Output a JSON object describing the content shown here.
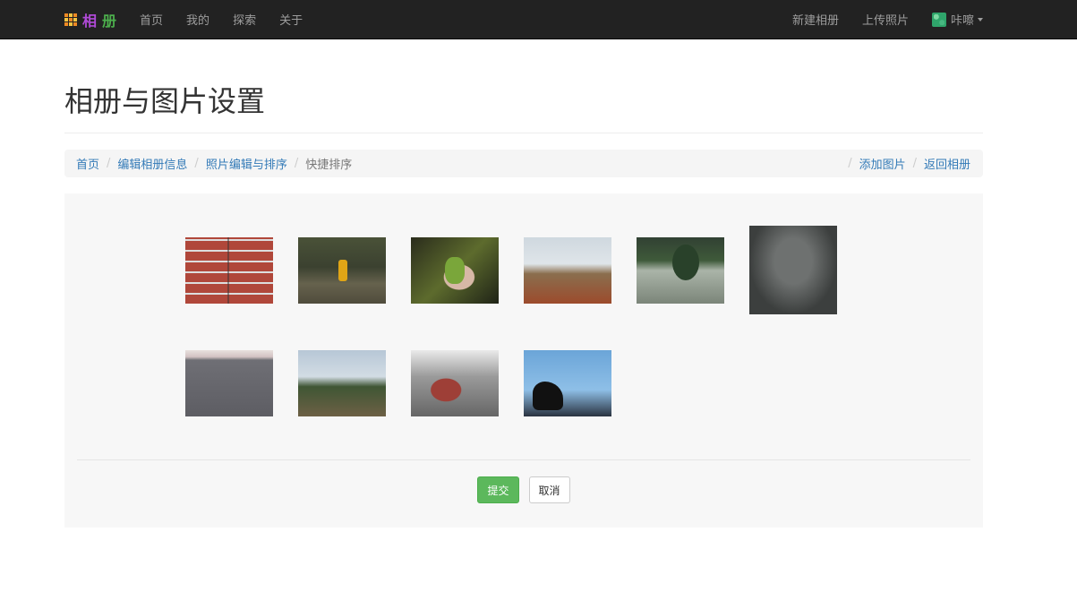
{
  "brand": {
    "chars": [
      "相",
      "册"
    ],
    "icon": "album-grid-icon",
    "char_colors": [
      "#b04ad8",
      "#4cae4c"
    ]
  },
  "nav": {
    "left": [
      "首页",
      "我的",
      "探索",
      "关于"
    ],
    "right": [
      "新建相册",
      "上传照片"
    ],
    "user_name": "咔嚓"
  },
  "page_title": "相册与图片设置",
  "breadcrumb": {
    "items": [
      "首页",
      "编辑相册信息",
      "照片编辑与排序"
    ],
    "active": "快捷排序",
    "right": [
      "添加图片",
      "返回相册"
    ]
  },
  "photos": [
    {
      "name": "brick-wall-photo"
    },
    {
      "name": "child-walking-photo"
    },
    {
      "name": "grasshopper-photo"
    },
    {
      "name": "field-trees-photo"
    },
    {
      "name": "tree-reflection-photo"
    },
    {
      "name": "water-photo"
    },
    {
      "name": "road-photo"
    },
    {
      "name": "country-road-photo"
    },
    {
      "name": "red-boot-photo"
    },
    {
      "name": "hand-sky-photo"
    }
  ],
  "actions": {
    "submit": "提交",
    "cancel": "取消"
  }
}
